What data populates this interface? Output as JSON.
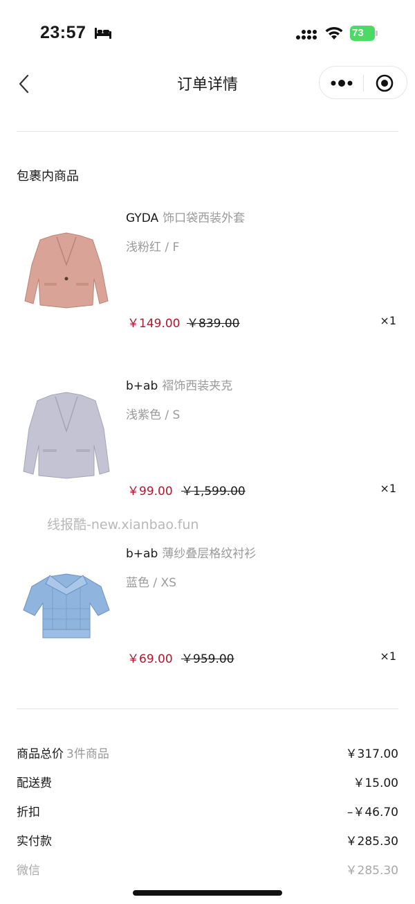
{
  "status_bar": {
    "time": "23:57",
    "battery": "73"
  },
  "nav": {
    "title": "订单详情"
  },
  "section": {
    "title": "包裹内商品"
  },
  "items": [
    {
      "brand": "GYDA",
      "name": "饰口袋西装外套",
      "variant": "浅粉红 / F",
      "price": "￥149.00",
      "original_price": "￥839.00",
      "qty": "×1",
      "image_color": "#d9a497"
    },
    {
      "brand": "b+ab",
      "name": "褶饰西装夹克",
      "variant": "浅紫色 / S",
      "price": "￥99.00",
      "original_price": "￥1,599.00",
      "qty": "×1",
      "image_color": "#c4c3d4"
    },
    {
      "brand": "b+ab",
      "name": "薄纱叠层格纹衬衫",
      "variant": "蓝色 / XS",
      "price": "￥69.00",
      "original_price": "￥959.00",
      "qty": "×1",
      "image_color": "#8fb4dd"
    }
  ],
  "watermark": "线报酷-new.xianbao.fun",
  "summary": {
    "goods_total_label": "商品总价",
    "goods_count": "3件商品",
    "goods_total": "￥317.00",
    "shipping_label": "配送费",
    "shipping": "￥15.00",
    "discount_label": "折扣",
    "discount": "–￥46.70",
    "paid_label": "实付款",
    "paid": "￥285.30",
    "payment_method_label": "微信",
    "payment_method_amount": "￥285.30"
  },
  "colors": {
    "price_red": "#b0182b",
    "battery_green": "#4cd964"
  }
}
